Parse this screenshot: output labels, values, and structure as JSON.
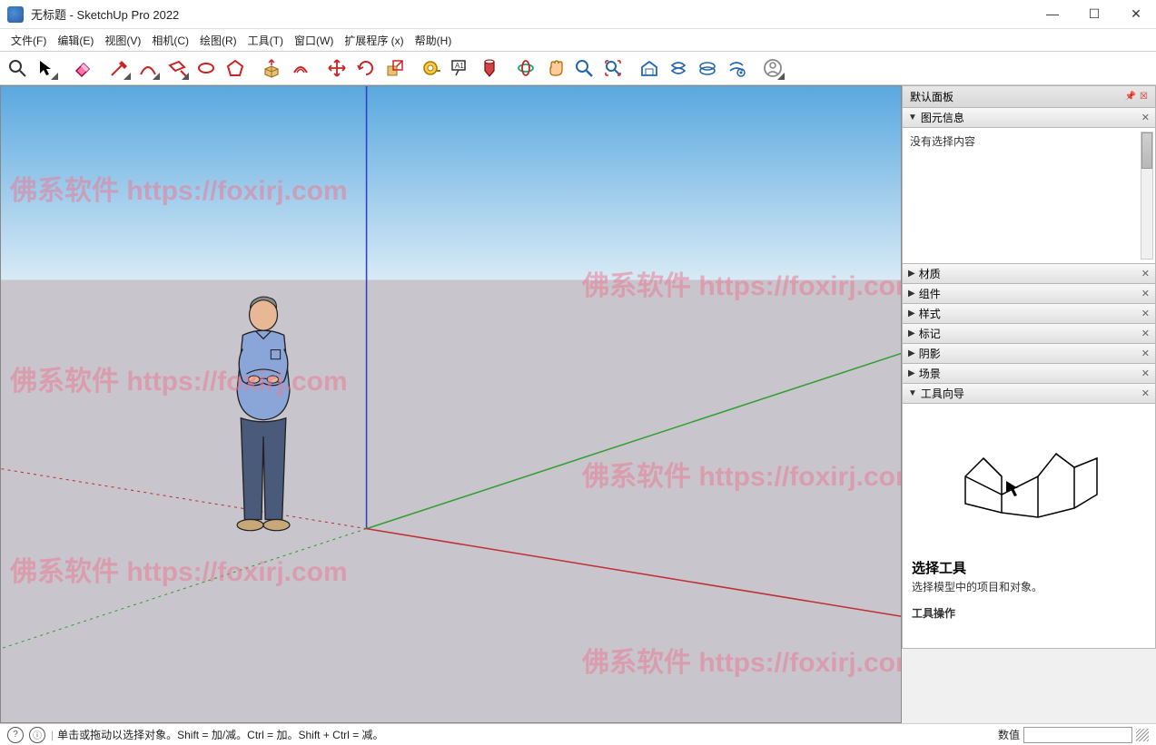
{
  "window": {
    "title": "无标题 - SketchUp Pro 2022"
  },
  "menu": {
    "file": "文件(F)",
    "edit": "编辑(E)",
    "view": "视图(V)",
    "camera": "相机(C)",
    "draw": "绘图(R)",
    "tools": "工具(T)",
    "window": "窗口(W)",
    "extensions": "扩展程序 (x)",
    "help": "帮助(H)"
  },
  "toolbar": {
    "search": "search-icon",
    "select": "select-icon",
    "eraser": "eraser-icon",
    "line": "line-icon",
    "arc": "arc-icon",
    "rectangle": "rectangle-icon",
    "circle": "circle-icon",
    "polygon": "polygon-icon",
    "pushpull": "pushpull-icon",
    "offset": "offset-icon",
    "move": "move-icon",
    "rotate": "rotate-icon",
    "scale": "scale-icon",
    "tape": "tape-icon",
    "text": "text-icon",
    "paint": "paint-icon",
    "orbit": "orbit-icon",
    "pan": "pan-icon",
    "zoom": "zoom-icon",
    "zoomextents": "zoomextents-icon",
    "warehouse": "warehouse-icon",
    "extwarehouse": "extwarehouse-icon",
    "layout": "layout-icon",
    "extmanager": "extmanager-icon",
    "user": "user-icon"
  },
  "panels": {
    "tray_title": "默认面板",
    "entity_info": {
      "header": "图元信息",
      "empty": "没有选择内容"
    },
    "materials": "材质",
    "components": "组件",
    "styles": "样式",
    "tags": "标记",
    "shadows": "阴影",
    "scenes": "场景",
    "instructor": {
      "header": "工具向导",
      "tool_title": "选择工具",
      "tool_desc": "选择模型中的项目和对象。",
      "sub_header": "工具操作"
    }
  },
  "statusbar": {
    "hint": "单击或拖动以选择对象。Shift = 加/减。Ctrl = 加。Shift + Ctrl = 减。",
    "measure_label": "数值"
  },
  "watermark": "佛系软件 https://foxirj.com",
  "colors": {
    "axis_red": "#c03030",
    "axis_green": "#30a030",
    "axis_blue": "#3030c0",
    "sky_top": "#5aa8e0",
    "sky_bottom": "#d8eaf5",
    "ground": "#c8c5cc"
  }
}
